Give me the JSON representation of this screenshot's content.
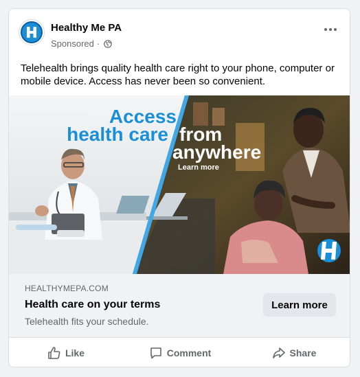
{
  "post": {
    "page_name": "Healthy Me PA",
    "sponsored": "Sponsored",
    "dot": "·",
    "body_text": "Telehealth brings quality health care right to your phone, computer or mobile device. Access has never been so convenient."
  },
  "creative": {
    "line1": "Access",
    "line2": "health care",
    "line3": "from",
    "line4": "anywhere",
    "cta_small": "Learn more",
    "brand_letter": "H",
    "colors": {
      "brand_blue": "#1a8fd8",
      "accent_blue": "#3ea8e8",
      "white": "#ffffff"
    }
  },
  "link": {
    "domain": "HEALTHYMEPA.COM",
    "headline": "Health care on your terms",
    "description": "Telehealth fits your schedule.",
    "button": "Learn more"
  },
  "actions": [
    {
      "label": "Like",
      "icon": "like-icon"
    },
    {
      "label": "Comment",
      "icon": "comment-icon"
    },
    {
      "label": "Share",
      "icon": "share-icon"
    }
  ]
}
